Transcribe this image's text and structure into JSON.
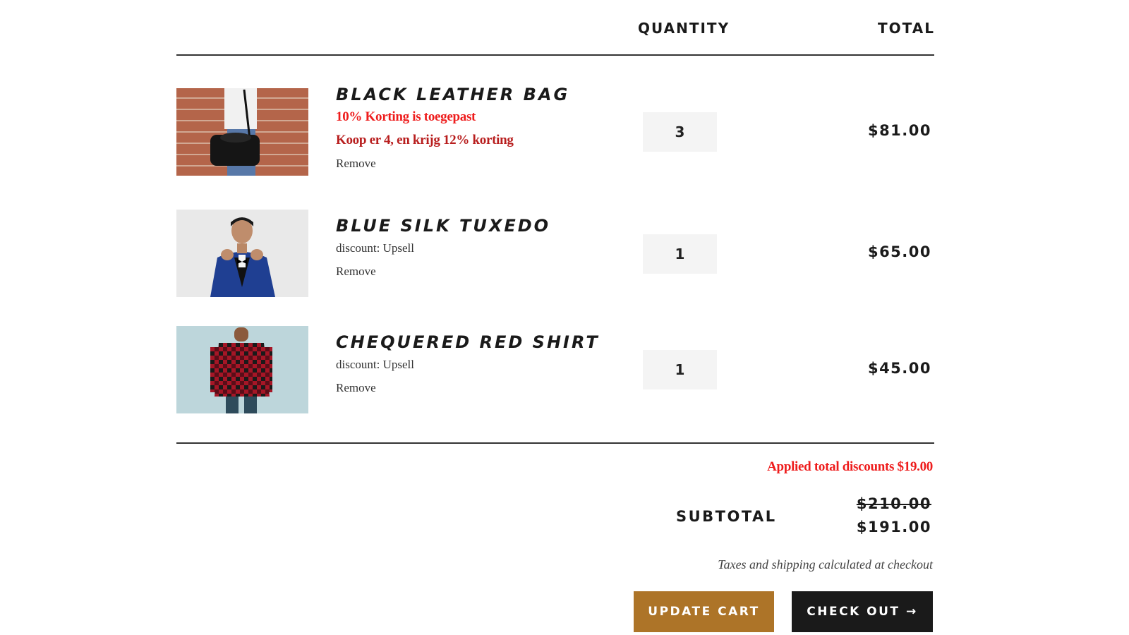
{
  "header": {
    "quantity": "QUANTITY",
    "total": "TOTAL"
  },
  "items": [
    {
      "name": "BLACK LEATHER BAG",
      "discount_lines": [
        "10% Korting is toegepast",
        "Koop er 4, en krijg 12% korting"
      ],
      "remove": "Remove",
      "quantity": "3",
      "total": "$81.00",
      "image": "black-leather-bag-photo"
    },
    {
      "name": "BLUE SILK TUXEDO",
      "discount": "discount: Upsell",
      "remove": "Remove",
      "quantity": "1",
      "total": "$65.00",
      "image": "blue-silk-tuxedo-photo"
    },
    {
      "name": "CHEQUERED RED SHIRT",
      "discount": "discount: Upsell",
      "remove": "Remove",
      "quantity": "1",
      "total": "$45.00",
      "image": "chequered-red-shirt-photo"
    }
  ],
  "summary": {
    "applied_discounts": "Applied total discounts $19.00",
    "subtotal_label": "SUBTOTAL",
    "subtotal_original": "$210.00",
    "subtotal_discounted": "$191.00",
    "taxes_note": "Taxes and shipping calculated at checkout"
  },
  "buttons": {
    "update_cart": "UPDATE CART",
    "check_out": "CHECK OUT →"
  },
  "colors": {
    "discount_red": "#ee1c1c",
    "discount_dark_red": "#b81e1e",
    "update_button": "#ad7428",
    "checkout_button": "#1a1a1a"
  }
}
